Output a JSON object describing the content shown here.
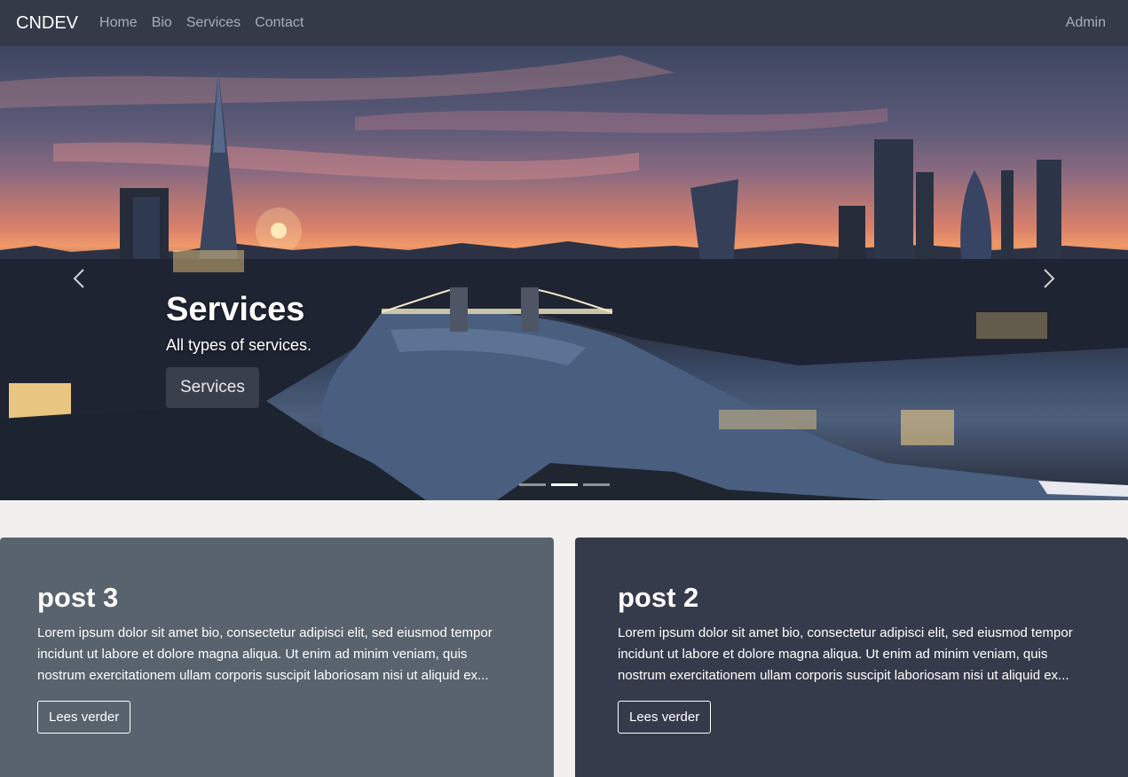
{
  "navbar": {
    "brand": "CNDEV",
    "links": [
      "Home",
      "Bio",
      "Services",
      "Contact"
    ],
    "right_link": "Admin",
    "background": "#343a48"
  },
  "hero": {
    "title": "Services",
    "text": "All types of services.",
    "button_label": "Services",
    "prev_icon": "chevron-left-icon",
    "next_icon": "chevron-right-icon",
    "slide_count": 3,
    "active_slide": 2
  },
  "posts": [
    {
      "title": "post 3",
      "body": "Lorem ipsum dolor sit amet bio, consectetur adipisci elit, sed eiusmod tempor incidunt ut labore et dolore magna aliqua. Ut enim ad minim veniam, quis nostrum exercitationem ullam corporis suscipit laboriosam nisi ut aliquid ex...",
      "button_label": "Lees verder",
      "background": "#58636d"
    },
    {
      "title": "post 2",
      "body": "Lorem ipsum dolor sit amet bio, consectetur adipisci elit, sed eiusmod tempor incidunt ut labore et dolore magna aliqua. Ut enim ad minim veniam, quis nostrum exercitationem ullam corporis suscipit laboriosam nisi ut aliquid ex...",
      "button_label": "Lees verder",
      "background": "#353b4a"
    }
  ]
}
